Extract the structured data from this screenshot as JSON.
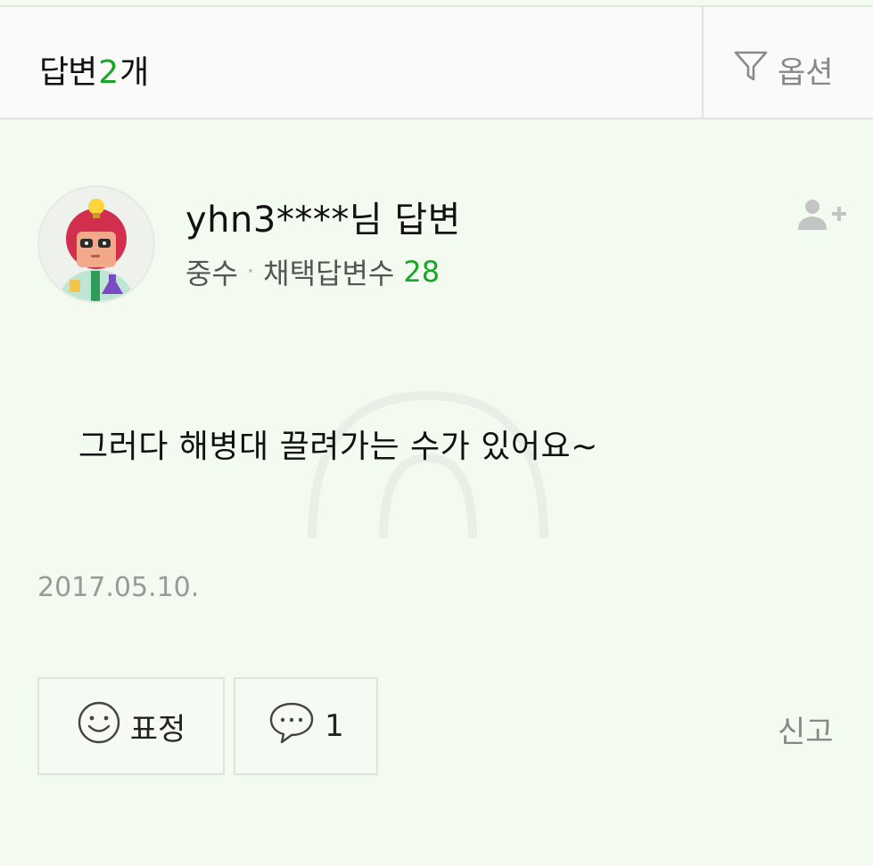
{
  "header": {
    "title_prefix": "답변 ",
    "count": "2",
    "title_suffix": "개",
    "options_label": "옵션",
    "options_icon": "filter-icon"
  },
  "answer": {
    "author": "yhn3****님 답변",
    "level": "중수",
    "separator": "·",
    "adopted_label": "채택답변수",
    "adopted_count": "28",
    "follow_icon": "add-user-icon",
    "body": "그러다 해병대 끌려가는 수가 있어요~",
    "date": "2017.05.10.",
    "emotion_label": "표정",
    "emotion_icon": "smiley-icon",
    "comment_count": "1",
    "comment_icon": "speech-bubble-icon",
    "report_label": "신고"
  },
  "colors": {
    "accent_green": "#1aa52a",
    "background": "#f3fbf1"
  }
}
